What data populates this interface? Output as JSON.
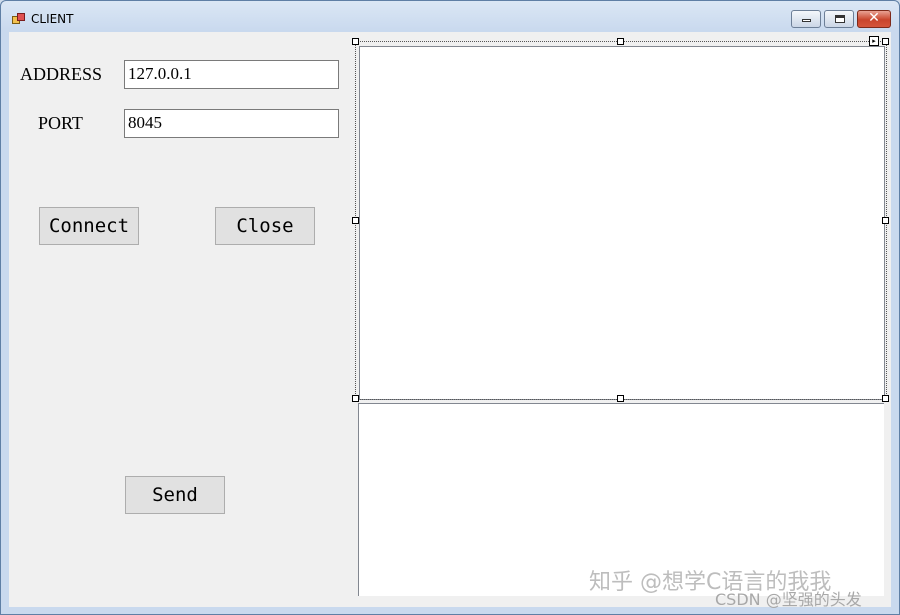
{
  "window": {
    "title": "CLIENT",
    "close_glyph": "✕"
  },
  "form": {
    "address_label": "ADDRESS",
    "address_value": "127.0.0.1",
    "port_label": "PORT",
    "port_value": "8045",
    "connect_label": "Connect",
    "close_label": "Close",
    "send_label": "Send"
  },
  "watermark": {
    "line1": "知乎 @想学C语言的我我",
    "line2": "CSDN @坚强的头发"
  },
  "icons": {
    "app": "app-form-icon",
    "minimize": "minimize-icon",
    "maximize": "maximize-icon",
    "close": "close-icon"
  }
}
